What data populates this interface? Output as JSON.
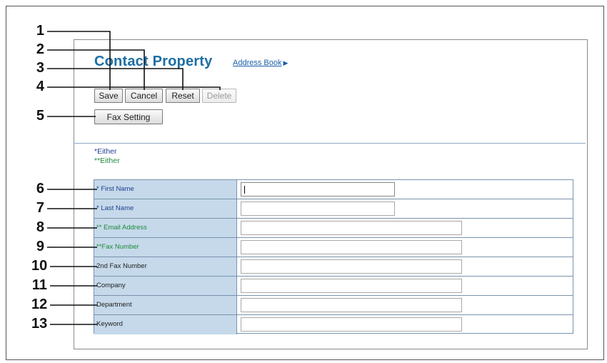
{
  "page": {
    "title": "Contact Property",
    "address_book_link": "Address Book",
    "address_book_arrow": "▶"
  },
  "toolbar": {
    "save": "Save",
    "cancel": "Cancel",
    "reset": "Reset",
    "delete": "Delete",
    "fax_setting": "Fax Setting"
  },
  "notes": {
    "either1": "*Either",
    "either2": "**Either"
  },
  "form": {
    "fields": [
      {
        "label": "* First Name",
        "value": ""
      },
      {
        "label": "* Last Name",
        "value": ""
      },
      {
        "label": "** Email Address",
        "value": ""
      },
      {
        "label": "**Fax Number",
        "value": ""
      },
      {
        "label": "2nd Fax Number",
        "value": ""
      },
      {
        "label": "Company",
        "value": ""
      },
      {
        "label": "Department",
        "value": ""
      },
      {
        "label": "Keyword",
        "value": ""
      }
    ]
  },
  "callouts": [
    "1",
    "2",
    "3",
    "4",
    "5",
    "6",
    "7",
    "8",
    "9",
    "10",
    "11",
    "12",
    "13"
  ]
}
